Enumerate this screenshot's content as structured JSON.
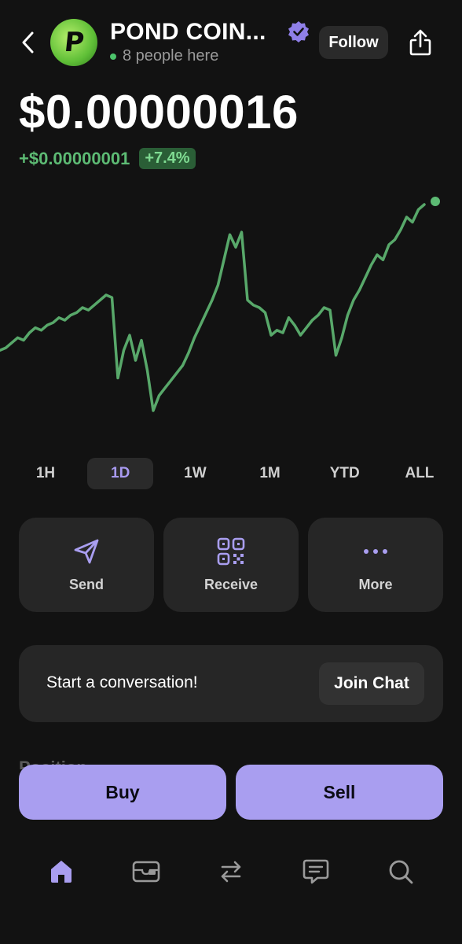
{
  "header": {
    "token_name": "POND COIN...",
    "avatar_letter": "P",
    "presence_text": "8 people here",
    "follow_label": "Follow"
  },
  "price": {
    "current": "$0.00000016",
    "change_amount": "+$0.00000001",
    "change_percent": "+7.4%"
  },
  "chart_data": {
    "type": "line",
    "series": [
      {
        "values": [
          0.86,
          0.87,
          0.89,
          0.91,
          0.9,
          0.93,
          0.95,
          0.94,
          0.96,
          0.97,
          0.99,
          0.98,
          1.0,
          1.01,
          1.03,
          1.02,
          1.04,
          1.06,
          1.08,
          1.07,
          0.75,
          0.86,
          0.92,
          0.82,
          0.9,
          0.78,
          0.62,
          0.68,
          0.71,
          0.74,
          0.77,
          0.8,
          0.85,
          0.91,
          0.96,
          1.01,
          1.06,
          1.12,
          1.22,
          1.32,
          1.27,
          1.33,
          1.06,
          1.04,
          1.03,
          1.01,
          0.92,
          0.94,
          0.93,
          0.99,
          0.96,
          0.92,
          0.95,
          0.98,
          1.0,
          1.03,
          1.02,
          0.84,
          0.91,
          1.0,
          1.06,
          1.1,
          1.15,
          1.2,
          1.24,
          1.22,
          1.28,
          1.3,
          1.34,
          1.39,
          1.37,
          1.42,
          1.44
        ],
        "color": "#58a86a"
      }
    ],
    "grid": false,
    "last_point_marker": true
  },
  "ranges": [
    "1H",
    "1D",
    "1W",
    "1M",
    "YTD",
    "ALL"
  ],
  "active_range": "1D",
  "actions": [
    {
      "label": "Send",
      "icon": "send-icon"
    },
    {
      "label": "Receive",
      "icon": "qr-code-icon"
    },
    {
      "label": "More",
      "icon": "more-dots-icon"
    }
  ],
  "chat": {
    "prompt": "Start a conversation!",
    "button_label": "Join Chat"
  },
  "position_heading": "Position",
  "trade": {
    "buy_label": "Buy",
    "sell_label": "Sell"
  },
  "nav": [
    "home-icon",
    "wallet-icon",
    "swap-icon",
    "chat-icon",
    "search-icon"
  ],
  "colors": {
    "background": "#121212",
    "accent": "#a99ef0",
    "positive": "#5dbb74",
    "card": "#262626"
  }
}
